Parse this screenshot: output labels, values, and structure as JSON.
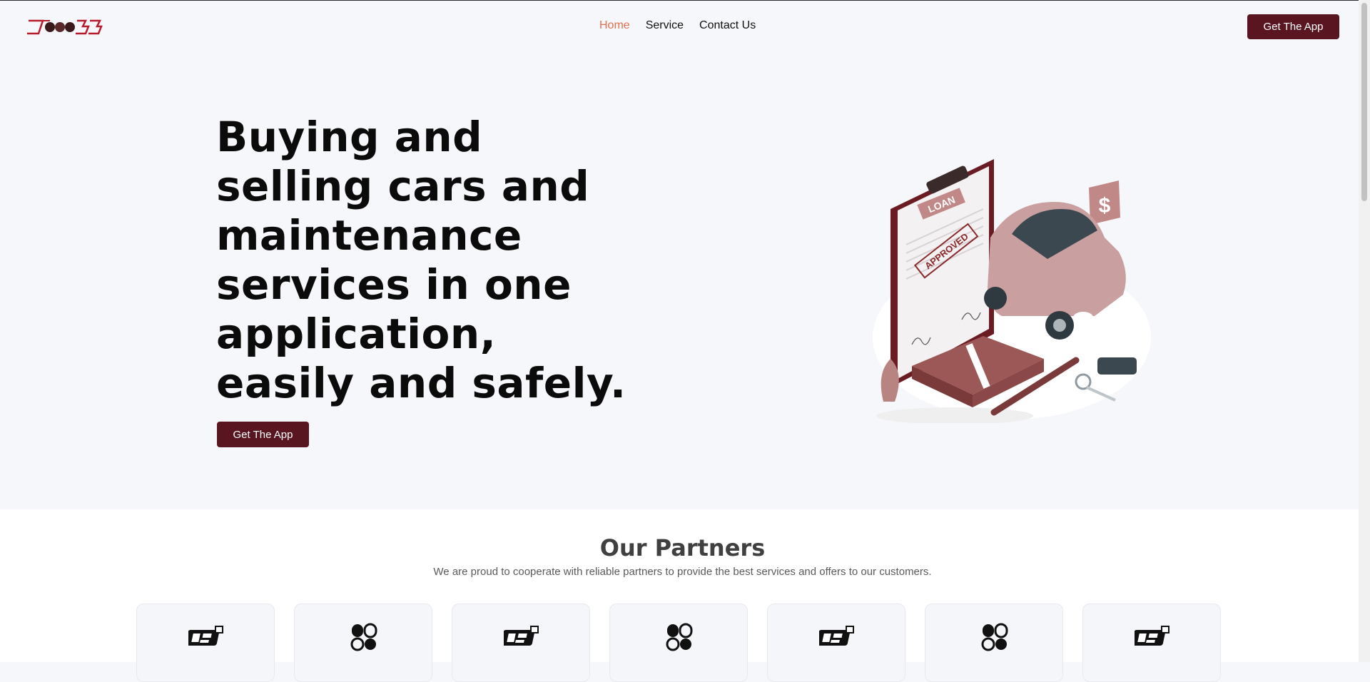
{
  "header": {
    "logo_alt": "DoneGG logo",
    "nav": [
      {
        "label": "Home",
        "active": true
      },
      {
        "label": "Service",
        "active": false
      },
      {
        "label": "Contact Us",
        "active": false
      }
    ],
    "cta_label": "Get The App"
  },
  "hero": {
    "title": "Buying and selling cars and maintenance services in one application, easily and safely.",
    "cta_label": "Get The App",
    "illustration": {
      "loan_label": "LOAN",
      "stamp_label": "APPROVED",
      "dollar_sign": "$"
    }
  },
  "partners": {
    "title": "Our Partners",
    "subtitle": "We are proud to cooperate with reliable partners to provide the best services and offers to our customers.",
    "cards": [
      {
        "icon": "partner-logo-a-icon"
      },
      {
        "icon": "partner-logo-b-icon"
      },
      {
        "icon": "partner-logo-a-icon"
      },
      {
        "icon": "partner-logo-b-icon"
      },
      {
        "icon": "partner-logo-a-icon"
      },
      {
        "icon": "partner-logo-b-icon"
      },
      {
        "icon": "partner-logo-a-icon"
      }
    ]
  },
  "colors": {
    "brand": "#5a1620",
    "nav_active": "#e0704f",
    "page_bg": "#f6f7fb"
  }
}
